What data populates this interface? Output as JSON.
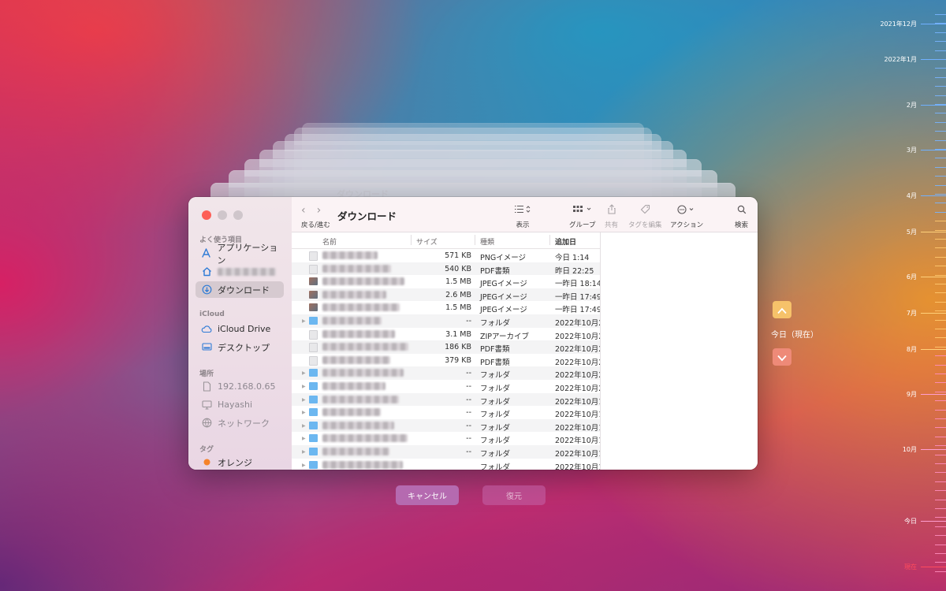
{
  "window": {
    "title": "ダウンロード",
    "nav_label": "戻る/進む",
    "background_title": "ダウンロード"
  },
  "toolbar": {
    "view_label": "表示",
    "group_label": "グループ",
    "share_label": "共有",
    "tag_label": "タグを編集",
    "action_label": "アクション",
    "search_label": "検索"
  },
  "sidebar": {
    "favorites_header": "よく使う項目",
    "icloud_header": "iCloud",
    "locations_header": "場所",
    "tags_header": "タグ",
    "favorites": [
      {
        "label": "アプリケーション",
        "icon": "apps-icon"
      },
      {
        "label": "",
        "icon": "home-icon"
      },
      {
        "label": "ダウンロード",
        "icon": "download-icon"
      }
    ],
    "icloud": [
      {
        "label": "iCloud Drive",
        "icon": "cloud-icon"
      },
      {
        "label": "デスクトップ",
        "icon": "desktop-icon"
      }
    ],
    "locations": [
      {
        "label": "192.168.0.65",
        "icon": "doc-icon"
      },
      {
        "label": "Hayashi",
        "icon": "display-icon"
      },
      {
        "label": "ネットワーク",
        "icon": "network-icon"
      }
    ],
    "tags": [
      {
        "label": "オレンジ",
        "color": "#f5832a"
      }
    ]
  },
  "columns": {
    "name": "名前",
    "size": "サイズ",
    "kind": "種類",
    "added": "追加日"
  },
  "files": [
    {
      "size": "571 KB",
      "kind": "PNGイメージ",
      "added": "今日 1:14",
      "icon": "doc"
    },
    {
      "size": "540 KB",
      "kind": "PDF書類",
      "added": "昨日 22:25",
      "icon": "doc"
    },
    {
      "size": "1.5 MB",
      "kind": "JPEGイメージ",
      "added": "一昨日 18:14",
      "icon": "img"
    },
    {
      "size": "2.6 MB",
      "kind": "JPEGイメージ",
      "added": "一昨日 17:49",
      "icon": "img"
    },
    {
      "size": "1.5 MB",
      "kind": "JPEGイメージ",
      "added": "一昨日 17:49",
      "icon": "img"
    },
    {
      "size": "--",
      "kind": "フォルダ",
      "added": "2022年10月2",
      "icon": "folder"
    },
    {
      "size": "3.1 MB",
      "kind": "ZIPアーカイブ",
      "added": "2022年10月2",
      "icon": "doc"
    },
    {
      "size": "186 KB",
      "kind": "PDF書類",
      "added": "2022年10月2",
      "icon": "doc"
    },
    {
      "size": "379 KB",
      "kind": "PDF書類",
      "added": "2022年10月2",
      "icon": "doc"
    },
    {
      "size": "--",
      "kind": "フォルダ",
      "added": "2022年10月2",
      "icon": "folder"
    },
    {
      "size": "--",
      "kind": "フォルダ",
      "added": "2022年10月2",
      "icon": "folder"
    },
    {
      "size": "--",
      "kind": "フォルダ",
      "added": "2022年10月1",
      "icon": "folder"
    },
    {
      "size": "--",
      "kind": "フォルダ",
      "added": "2022年10月1",
      "icon": "folder"
    },
    {
      "size": "--",
      "kind": "フォルダ",
      "added": "2022年10月1",
      "icon": "folder"
    },
    {
      "size": "--",
      "kind": "フォルダ",
      "added": "2022年10月1",
      "icon": "folder"
    },
    {
      "size": "--",
      "kind": "フォルダ",
      "added": "2022年10月1",
      "icon": "folder"
    },
    {
      "size": "",
      "kind": "フォルダ",
      "added": "2022年10月1",
      "icon": "folder"
    }
  ],
  "buttons": {
    "cancel": "キャンセル",
    "restore": "復元"
  },
  "navigator": {
    "today_label": "今日（現在）"
  },
  "timeline": [
    {
      "label": "2021年12月"
    },
    {
      "label": "2022年1月"
    },
    {
      "label": "2月"
    },
    {
      "label": "3月"
    },
    {
      "label": "4月"
    },
    {
      "label": "5月"
    },
    {
      "label": "6月"
    },
    {
      "label": "7月"
    },
    {
      "label": "8月"
    },
    {
      "label": "9月"
    },
    {
      "label": "10月"
    },
    {
      "label": "今日"
    },
    {
      "label": "現在",
      "color": "#ff4b5c"
    }
  ]
}
